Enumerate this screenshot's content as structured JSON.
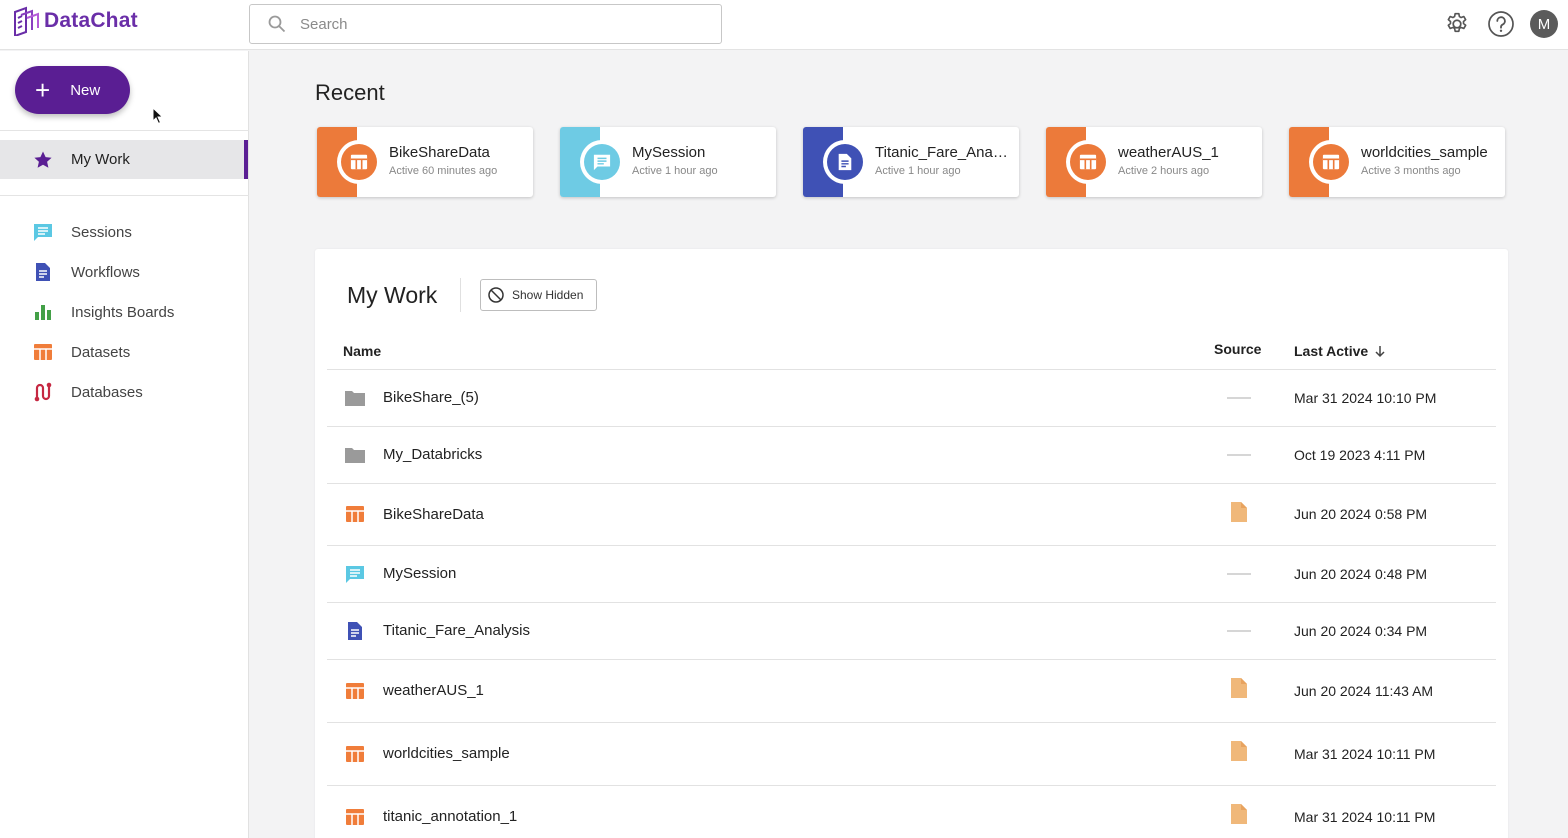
{
  "app": {
    "name": "DataChat",
    "brand_color": "#6a2ea8"
  },
  "search": {
    "placeholder": "Search"
  },
  "topbar": {
    "icons": [
      "gear-icon",
      "help-icon"
    ],
    "avatar_initial": "M"
  },
  "sidebar": {
    "new_label": "New",
    "active_item": "My Work",
    "items": [
      {
        "label": "Sessions",
        "icon": "sessions-icon",
        "color": "#5bc8e3"
      },
      {
        "label": "Workflows",
        "icon": "workflow-icon",
        "color": "#3f51b5"
      },
      {
        "label": "Insights Boards",
        "icon": "bar-chart-icon",
        "color": "#43a047"
      },
      {
        "label": "Datasets",
        "icon": "dataset-icon",
        "color": "#f07d3a"
      },
      {
        "label": "Databases",
        "icon": "database-icon",
        "color": "#c62842"
      }
    ]
  },
  "recent": {
    "title": "Recent",
    "cards": [
      {
        "name": "BikeShareData",
        "sub": "Active 60 minutes ago",
        "type": "dataset",
        "color": "#ec7a3a"
      },
      {
        "name": "MySession",
        "sub": "Active 1 hour ago",
        "type": "session",
        "color": "#6ecbe4"
      },
      {
        "name": "Titanic_Fare_Anal…",
        "sub": "Active 1 hour ago",
        "type": "workflow",
        "color": "#3f51b5"
      },
      {
        "name": "weatherAUS_1",
        "sub": "Active 2 hours ago",
        "type": "dataset",
        "color": "#ec7a3a"
      },
      {
        "name": "worldcities_sample",
        "sub": "Active 3 months ago",
        "type": "dataset",
        "color": "#ec7a3a"
      }
    ]
  },
  "mywork": {
    "title": "My Work",
    "show_hidden_label": "Show Hidden",
    "columns": {
      "name": "Name",
      "source": "Source",
      "last_active": "Last Active"
    },
    "rows": [
      {
        "name": "BikeShare_(5)",
        "type": "folder",
        "source": "none",
        "date": "Mar 31 2024 10:10 PM"
      },
      {
        "name": "My_Databricks",
        "type": "folder",
        "source": "none",
        "date": "Oct 19 2023 4:11 PM"
      },
      {
        "name": "BikeShareData",
        "type": "dataset",
        "source": "file",
        "date": "Jun 20 2024 0:58 PM"
      },
      {
        "name": "MySession",
        "type": "session",
        "source": "none",
        "date": "Jun 20 2024 0:48 PM"
      },
      {
        "name": "Titanic_Fare_Analysis",
        "type": "workflow",
        "source": "none",
        "date": "Jun 20 2024 0:34 PM"
      },
      {
        "name": "weatherAUS_1",
        "type": "dataset",
        "source": "file",
        "date": "Jun 20 2024 11:43 AM"
      },
      {
        "name": "worldcities_sample",
        "type": "dataset",
        "source": "file",
        "date": "Mar 31 2024 10:11 PM"
      },
      {
        "name": "titanic_annotation_1",
        "type": "dataset",
        "source": "file",
        "date": "Mar 31 2024 10:11 PM"
      }
    ]
  }
}
